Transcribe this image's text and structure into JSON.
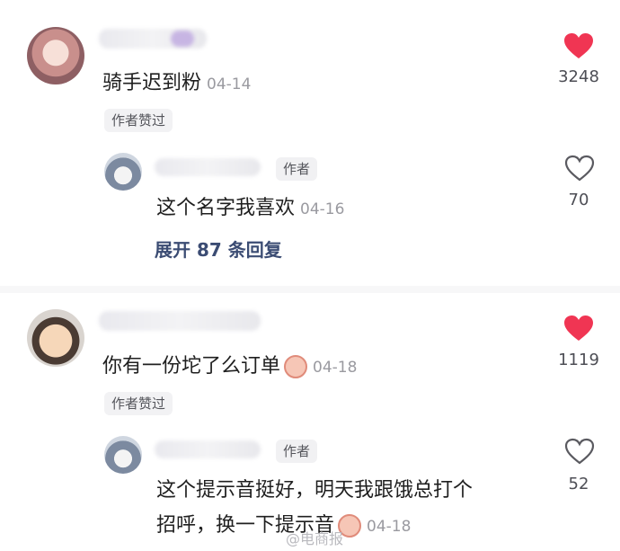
{
  "comments": [
    {
      "text": "骑手迟到粉",
      "date": "04-14",
      "badge": "作者赞过",
      "likes": "3248",
      "liked": true,
      "reply": {
        "tag": "作者",
        "text": "这个名字我喜欢",
        "date": "04-16",
        "likes": "70",
        "liked": false
      },
      "expand": "展开 87 条回复"
    },
    {
      "text": "你有一份坨了么订单",
      "date": "04-18",
      "badge": "作者赞过",
      "likes": "1119",
      "liked": true,
      "reply": {
        "tag": "作者",
        "text_line1": "这个提示音挺好，明天我跟饿总打个",
        "text_line2": "招呼，换一下提示音",
        "date": "04-18",
        "likes": "52",
        "liked": false
      }
    }
  ],
  "watermark": "@电商报",
  "colors": {
    "heart_liked": "#f03553",
    "heart_outline": "#5a5a60",
    "expand": "#3b4c73"
  }
}
